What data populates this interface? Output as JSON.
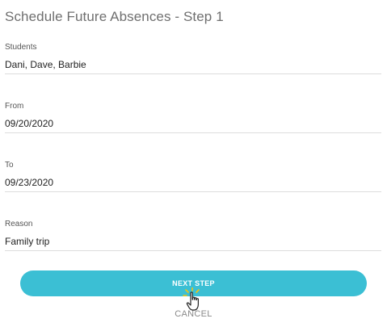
{
  "page": {
    "title": "Schedule Future Absences - Step 1"
  },
  "form": {
    "students": {
      "label": "Students",
      "value": "Dani, Dave, Barbie"
    },
    "from": {
      "label": "From",
      "value": "09/20/2020"
    },
    "to": {
      "label": "To",
      "value": "09/23/2020"
    },
    "reason": {
      "label": "Reason",
      "value": "Family trip"
    }
  },
  "actions": {
    "next_label": "NEXT STEP",
    "cancel_label": "CANCEL"
  },
  "colors": {
    "accent": "#3bbfd4",
    "title_text": "#6f6f6f",
    "divider": "#dddddd"
  },
  "icons": {
    "cursor": "hand-pointer-icon"
  }
}
